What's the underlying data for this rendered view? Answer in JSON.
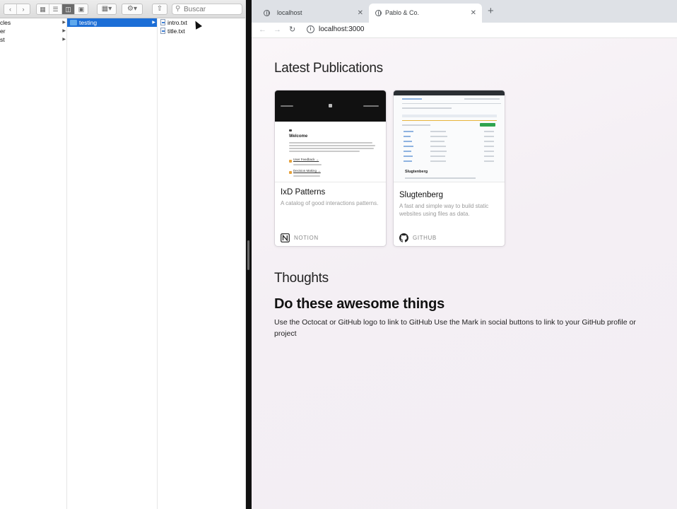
{
  "finder": {
    "search_placeholder": "Buscar",
    "columns": [
      {
        "items": [
          {
            "label": "cles",
            "folder": false,
            "arrow": true
          },
          {
            "label": "er",
            "folder": false,
            "arrow": true
          },
          {
            "label": "st",
            "folder": false,
            "arrow": true
          }
        ]
      },
      {
        "items": [
          {
            "label": "testing",
            "selected": true
          }
        ]
      },
      {
        "items": [
          {
            "label": "intro.txt"
          },
          {
            "label": "title.txt"
          }
        ]
      }
    ]
  },
  "browser": {
    "tabs": [
      {
        "title": "localhost",
        "active": false
      },
      {
        "title": "Pablo & Co.",
        "active": true
      }
    ],
    "url": "localhost:3000"
  },
  "page": {
    "publications_heading": "Latest Publications",
    "cards": [
      {
        "title": "IxD Patterns",
        "description": "A catalog of good interactions patterns.",
        "source": "NOTION",
        "thumb_welcome": "Welcome",
        "thumb_link1": "User Feedback →",
        "thumb_link2": "Decision Making →"
      },
      {
        "title": "Slugtenberg",
        "description": "A fast and simple way to build static websites using files as data.",
        "source": "GITHUB",
        "thumb_heading": "Slugtenberg"
      }
    ],
    "thoughts_heading": "Thoughts",
    "thought": {
      "title": "Do these awesome things",
      "text": "Use the Octocat or GitHub logo to link to GitHub Use the Mark in social buttons to link to your GitHub profile or project"
    }
  },
  "colors": {
    "finder_selection": "#1c6ed6",
    "folder": "#5fa9ed",
    "page_bg": "#f4eff4",
    "tabstrip": "#dee1e6"
  },
  "icons": [
    "chevron-left-icon",
    "chevron-right-icon",
    "icon-view-icon",
    "list-view-icon",
    "column-view-icon",
    "gallery-view-icon",
    "group-icon",
    "gear-icon",
    "share-icon",
    "search-icon",
    "folder-icon",
    "text-file-icon",
    "globe-icon",
    "close-icon",
    "plus-icon",
    "back-icon",
    "forward-icon",
    "reload-icon",
    "info-icon",
    "notion-logo-icon",
    "github-logo-icon"
  ]
}
